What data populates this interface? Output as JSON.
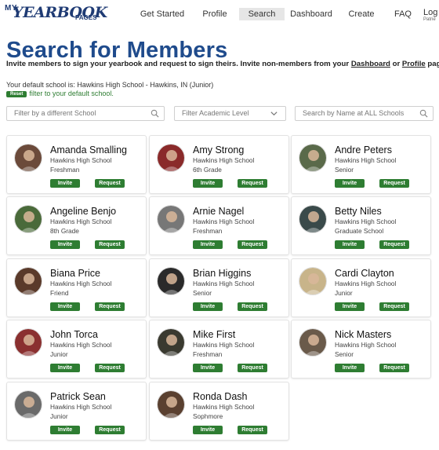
{
  "logo": {
    "my": "MY",
    "yearbook": "YEARBOOK",
    "pages": "PAGES"
  },
  "nav": {
    "items": [
      {
        "label": "Get Started"
      },
      {
        "label": "Profile"
      },
      {
        "label": "Search"
      },
      {
        "label": "Dashboard"
      },
      {
        "label": "Create"
      },
      {
        "label": "FAQ"
      }
    ],
    "active": "Search",
    "login": "Log",
    "login_sub": "Patrie"
  },
  "header": {
    "title": "Search for Members",
    "subtitle_pre": "Invite members to sign your yearbook and request to sign theirs. Invite non-members from your ",
    "subtitle_link1": "Dashboard",
    "subtitle_mid": " or ",
    "subtitle_link2": "Profile",
    "subtitle_post": " page.",
    "default_school": "Your default school is: Hawkins High School - Hawkins, IN (Junior)",
    "reset_label": "Reset",
    "reset_text": "filter to your default school."
  },
  "filters": {
    "school_placeholder": "Filter by a different School",
    "level_placeholder": "Filter Academic Level",
    "name_placeholder": "Search by Name at ALL Schools"
  },
  "buttons": {
    "invite": "Invite",
    "request": "Request"
  },
  "members": [
    {
      "name": "Amanda Smalling",
      "school": "Hawkins High School",
      "level": "Freshman",
      "avatar_color": "#6b4a3a"
    },
    {
      "name": "Amy Strong",
      "school": "Hawkins High School",
      "level": "6th Grade",
      "avatar_color": "#8a2a2a"
    },
    {
      "name": "Andre Peters",
      "school": "Hawkins High School",
      "level": "Senior",
      "avatar_color": "#5a6a4a"
    },
    {
      "name": "Angeline Benjo",
      "school": "Hawkins High School",
      "level": "8th Grade",
      "avatar_color": "#4a6a3a"
    },
    {
      "name": "Arnie Nagel",
      "school": "Hawkins High School",
      "level": "Freshman",
      "avatar_color": "#777777"
    },
    {
      "name": "Betty Niles",
      "school": "Hawkins High School",
      "level": "Graduate School",
      "avatar_color": "#3a4a4a"
    },
    {
      "name": "Biana Price",
      "school": "Hawkins High School",
      "level": "Friend",
      "avatar_color": "#5a3a2a"
    },
    {
      "name": "Brian Higgins",
      "school": "Hawkins High School",
      "level": "Senior",
      "avatar_color": "#2a2a2a"
    },
    {
      "name": "Cardi Clayton",
      "school": "Hawkins High School",
      "level": "Junior",
      "avatar_color": "#c8b48a"
    },
    {
      "name": "John Torca",
      "school": "Hawkins High School",
      "level": "Junior",
      "avatar_color": "#8a3030"
    },
    {
      "name": "Mike First",
      "school": "Hawkins High School",
      "level": "Freshman",
      "avatar_color": "#3a3a30"
    },
    {
      "name": "Nick Masters",
      "school": "Hawkins High School",
      "level": "Senior",
      "avatar_color": "#6a5a4a"
    },
    {
      "name": "Patrick Sean",
      "school": "Hawkins High School",
      "level": "Junior",
      "avatar_color": "#6a6a6a"
    },
    {
      "name": "Ronda Dash",
      "school": "Hawkins High School",
      "level": "Sophmore",
      "avatar_color": "#5a4030"
    }
  ],
  "colors": {
    "brand": "#1f4b8c",
    "button": "#2e7d32",
    "logo": "#1f3b74"
  }
}
